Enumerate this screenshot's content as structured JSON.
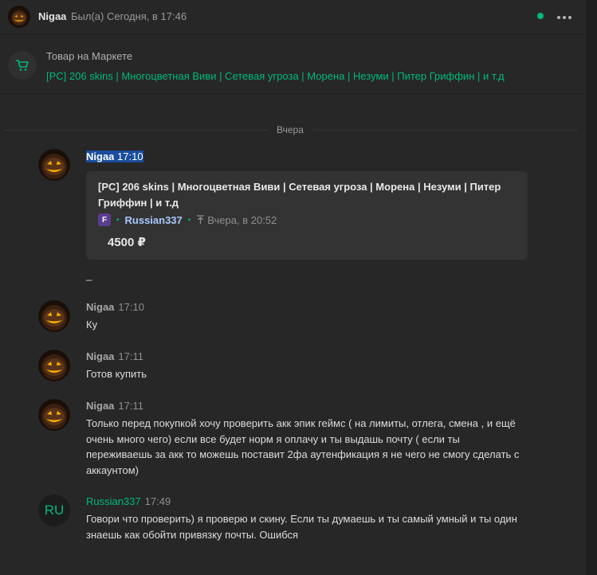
{
  "header": {
    "name": "Nigaa",
    "status": "Был(а) Сегодня, в 17:46"
  },
  "market": {
    "label": "Товар на Маркете",
    "link": "[PC] 206 skins | Многоцветная Виви | Сетевая угроза | Морена | Незуми | Питер Гриффин | и т.д"
  },
  "divider": "Вчера",
  "messages": [
    {
      "author": "Nigaa",
      "time": "17:10",
      "card": {
        "title": "[PC] 206 skins | Многоцветная Виви | Сетевая угроза | Морена | Незуми | Питер Гриффин | и т.д",
        "game_icon": "F",
        "seller": "Russian337",
        "uploaded": "Вчера, в 20:52",
        "price": "4500 ₽"
      },
      "text": "_"
    },
    {
      "author": "Nigaa",
      "time": "17:10",
      "text": "Ку"
    },
    {
      "author": "Nigaa",
      "time": "17:11",
      "text": "Готов купить"
    },
    {
      "author": "Nigaa",
      "time": "17:11",
      "text": "Только перед покупкой хочу проверить акк эпик геймс ( на лимиты, отлега, смена , и ещё очень много чего) если все будет норм я оплачу и ты выдашь почту ( если ты переживаешь за акк то можешь поставит 2фа аутенфикация я не чего не смогу сделать с аккаунтом)"
    },
    {
      "author": "Russian337",
      "avatar_text": "RU",
      "time": "17:49",
      "text": "Говори что проверить) я проверю и скину. Если ты думаешь и ты самый умный и ты один знаешь как обойти привязку почты. Ошибся"
    }
  ],
  "colors": {
    "background": "#272727",
    "accent_green": "#00ba78",
    "card_bg": "#333333",
    "selection": "#1a4d9e"
  },
  "icons": [
    "cart-icon",
    "upload-arrow-icon",
    "more-dots-icon",
    "online-dot-icon"
  ]
}
